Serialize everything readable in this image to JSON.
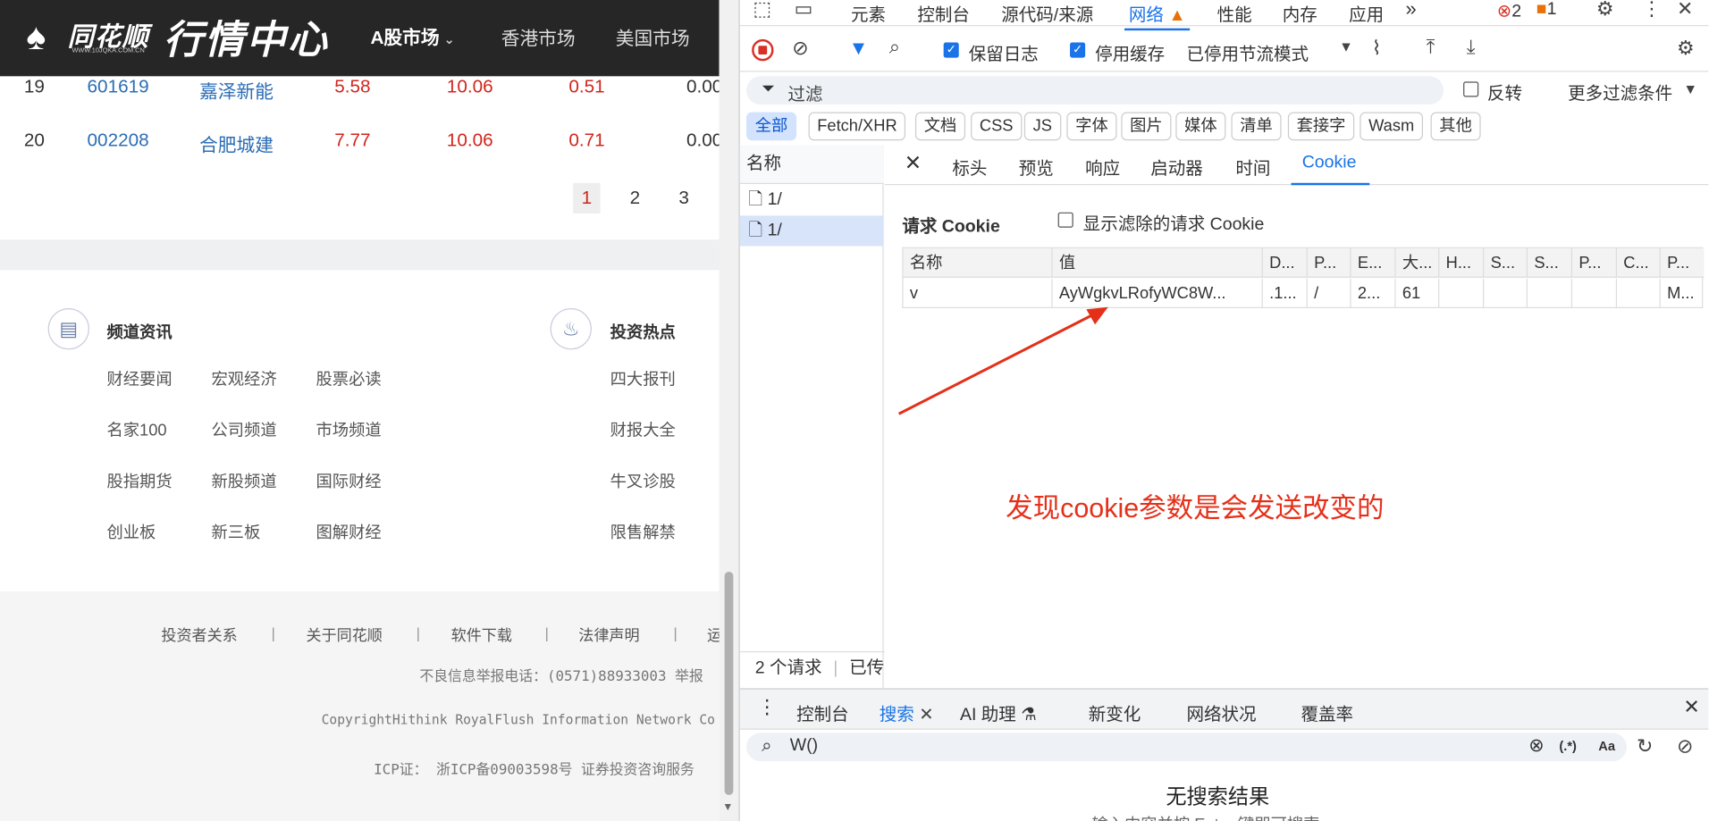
{
  "site": {
    "brand": "同花顺",
    "domain": "WWW.10JQKA.COM.CN",
    "title": "行情中心",
    "nav": {
      "a_share": "A股市场",
      "hk": "香港市场",
      "us": "美国市场"
    }
  },
  "table_rows": [
    {
      "no": "19",
      "code": "601619",
      "name": "嘉泽新能",
      "price": "5.58",
      "change_pct": "10.06",
      "change": "0.51",
      "last": "0.00"
    },
    {
      "no": "20",
      "code": "002208",
      "name": "合肥城建",
      "price": "7.77",
      "change_pct": "10.06",
      "change": "0.71",
      "last": "0.00"
    }
  ],
  "pager": [
    "1",
    "2",
    "3"
  ],
  "sections": {
    "channel": {
      "title": "频道资讯",
      "links": [
        "财经要闻",
        "宏观经济",
        "股票必读",
        "名家100",
        "公司频道",
        "市场频道",
        "股指期货",
        "新股频道",
        "国际财经",
        "创业板",
        "新三板",
        "图解财经"
      ]
    },
    "hot": {
      "title": "投资热点",
      "links": [
        "四大报刊",
        "财报大全",
        "牛叉诊股",
        "限售解禁"
      ]
    }
  },
  "footer": {
    "links": [
      "投资者关系",
      "关于同花顺",
      "软件下载",
      "法律声明",
      "运"
    ],
    "sep": "|",
    "report": "不良信息举报电话：(0571)88933003 举报",
    "copyright": "CopyrightHithink RoyalFlush Information Network Co",
    "icp": "ICP证： 浙ICP备09003598号 证券投资咨询服务"
  },
  "devtools": {
    "tabs": [
      "元素",
      "控制台",
      "源代码/来源",
      "网络",
      "性能",
      "内存",
      "应用"
    ],
    "active_tab": "网络",
    "more": "»",
    "errors": "2",
    "warnings": "1",
    "toolbar": {
      "preserve_log": "保留日志",
      "disable_cache": "停用缓存",
      "throttle": "已停用节流模式"
    },
    "filter": {
      "placeholder": "过滤",
      "invert": "反转",
      "more_filters": "更多过滤条件"
    },
    "chips": [
      "全部",
      "Fetch/XHR",
      "文档",
      "CSS",
      "JS",
      "字体",
      "图片",
      "媒体",
      "清单",
      "套接字",
      "Wasm",
      "其他"
    ],
    "requests_header": "名称",
    "requests": [
      "1/",
      "1/"
    ],
    "detail_tabs": [
      "标头",
      "预览",
      "响应",
      "启动器",
      "时间",
      "Cookie"
    ],
    "active_detail_tab": "Cookie",
    "request_cookie_label": "请求 Cookie",
    "show_filtered": "显示滤除的请求 Cookie",
    "cookie_columns": [
      "名称",
      "值",
      "D...",
      "P...",
      "E...",
      "大...",
      "H...",
      "S...",
      "S...",
      "P...",
      "C...",
      "P..."
    ],
    "cookie_row": [
      "v",
      "AyWgkvLRofyWC8W...",
      ".1...",
      "/",
      "2...",
      "61",
      "",
      "",
      "",
      "",
      "",
      "M..."
    ],
    "annotation": "发现cookie参数是会发送改变的",
    "status": {
      "count": "2 个请求",
      "transferred": "已传"
    },
    "drawer_tabs": [
      "控制台",
      "搜索",
      "AI 助理",
      "新变化",
      "网络状况",
      "覆盖率"
    ],
    "active_drawer_tab": "搜索",
    "search_query": "W()",
    "search_regex": "(.*)",
    "search_case": "Aa",
    "no_results": "无搜索结果",
    "hint": "输入内容并按 Enter 键即可搜索"
  }
}
